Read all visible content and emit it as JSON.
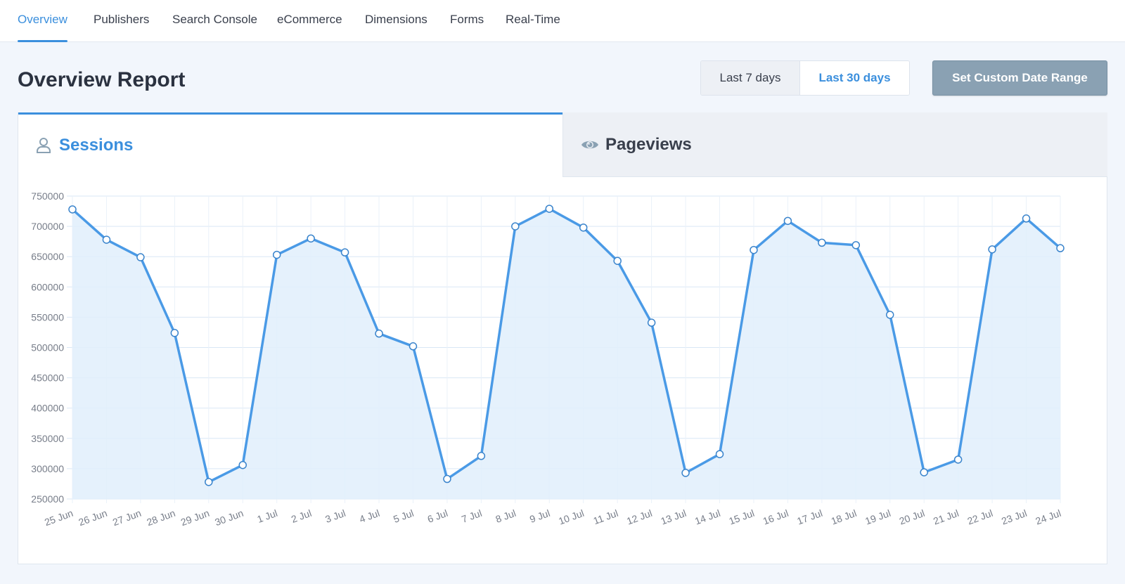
{
  "nav": {
    "tabs": [
      {
        "label": "Overview",
        "active": true
      },
      {
        "label": "Publishers",
        "active": false
      },
      {
        "label": "Search Console",
        "active": false
      },
      {
        "label": "eCommerce",
        "active": false
      },
      {
        "label": "Dimensions",
        "active": false
      },
      {
        "label": "Forms",
        "active": false
      },
      {
        "label": "Real-Time",
        "active": false
      }
    ]
  },
  "header": {
    "title": "Overview Report",
    "range_options": [
      "Last 7 days",
      "Last 30 days"
    ],
    "selected_range": "Last 30 days",
    "custom_range_label": "Set Custom Date Range"
  },
  "metrics": {
    "tabs": [
      {
        "label": "Sessions",
        "icon": "user-icon",
        "active": true
      },
      {
        "label": "Pageviews",
        "icon": "eye-icon",
        "active": false
      }
    ]
  },
  "colors": {
    "accent": "#3b8fdd",
    "line": "#4a9ae6",
    "fill": "#e1eefc",
    "grid": "#d9e7f5"
  },
  "chart_data": {
    "type": "area",
    "title": "Sessions",
    "xlabel": "",
    "ylabel": "",
    "ylim": [
      250000,
      750000
    ],
    "yticks": [
      250000,
      300000,
      350000,
      400000,
      450000,
      500000,
      550000,
      600000,
      650000,
      700000,
      750000
    ],
    "grid": true,
    "legend": "none",
    "categories": [
      "25 Jun",
      "26 Jun",
      "27 Jun",
      "28 Jun",
      "29 Jun",
      "30 Jun",
      "1 Jul",
      "2 Jul",
      "3 Jul",
      "4 Jul",
      "5 Jul",
      "6 Jul",
      "7 Jul",
      "8 Jul",
      "9 Jul",
      "10 Jul",
      "11 Jul",
      "12 Jul",
      "13 Jul",
      "14 Jul",
      "15 Jul",
      "16 Jul",
      "17 Jul",
      "18 Jul",
      "19 Jul",
      "20 Jul",
      "21 Jul",
      "22 Jul",
      "23 Jul",
      "24 Jul"
    ],
    "series": [
      {
        "name": "Sessions",
        "values": [
          728000,
          678000,
          649000,
          524000,
          278000,
          306000,
          653000,
          680000,
          657000,
          523000,
          502000,
          283000,
          321000,
          700000,
          729000,
          698000,
          643000,
          541000,
          293000,
          324000,
          661000,
          709000,
          673000,
          669000,
          554000,
          294000,
          315000,
          662000,
          713000,
          664000
        ]
      }
    ]
  }
}
